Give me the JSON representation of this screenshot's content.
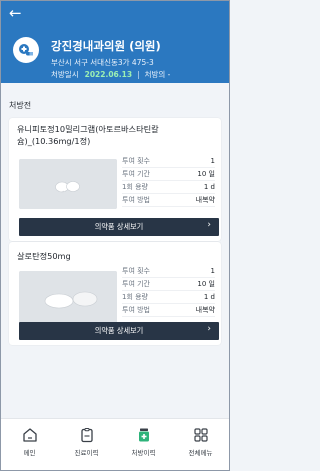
{
  "header": {
    "back_icon": "arrow-left-icon",
    "hospital_icon": "hospital-pill-icon",
    "hospital_name": "강진경내과의원 (의원)",
    "address": "부산시 서구 서대신동3가 475-3",
    "prescription_date_label": "처방일시",
    "prescription_date": "2022.06.13",
    "prescription_clinic_label": "처방의 -"
  },
  "section_title": "처방전",
  "drugs": [
    {
      "name": "유니피토정10밀리그램(아토르바스타틴칼슘)_(10.36mg/1정)",
      "rows": [
        {
          "label": "투여 횟수",
          "value": "1"
        },
        {
          "label": "투여 기간",
          "value": "10 일"
        },
        {
          "label": "1회 용량",
          "value": "1 d"
        },
        {
          "label": "투여 방법",
          "value": "내복약"
        }
      ],
      "button": "의약품 상세보기"
    },
    {
      "name": "살로탄정50mg",
      "rows": [
        {
          "label": "투여 횟수",
          "value": "1"
        },
        {
          "label": "투여 기간",
          "value": "10 일"
        },
        {
          "label": "1회 용량",
          "value": "1 d"
        },
        {
          "label": "투여 방법",
          "value": "내복약"
        }
      ],
      "button": "의약품 상세보기"
    }
  ],
  "nav": [
    {
      "label": "메인",
      "icon": "home-icon"
    },
    {
      "label": "진료이력",
      "icon": "clipboard-icon"
    },
    {
      "label": "처방이력",
      "icon": "pill-bottle-icon"
    },
    {
      "label": "전체메뉴",
      "icon": "grid-menu-icon"
    }
  ],
  "colors": {
    "header_bg": "#2b78c0",
    "date_accent": "#9cf0b2",
    "button_bg": "#283546",
    "page_bg": "#f1f4f8"
  }
}
